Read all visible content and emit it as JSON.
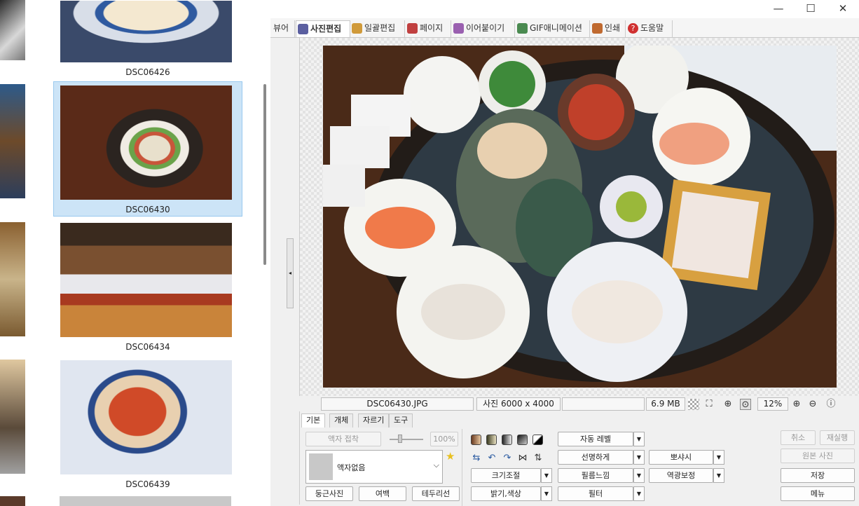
{
  "thumbnails": [
    {
      "name": "DSC06426"
    },
    {
      "name": "DSC06430"
    },
    {
      "name": "DSC06434"
    },
    {
      "name": "DSC06439"
    }
  ],
  "window": {
    "minimize": "—",
    "maximize": "☐",
    "close": "✕"
  },
  "tabs": [
    {
      "label": "뷰어",
      "color": "#5b7fbf"
    },
    {
      "label": "사진편집",
      "color": "#5b5fa0"
    },
    {
      "label": "일괄편집",
      "color": "#d09a3a"
    },
    {
      "label": "페이지",
      "color": "#c04040"
    },
    {
      "label": "이어붙이기",
      "color": "#9a60b0"
    },
    {
      "label": "GIF애니메이션",
      "color": "#4a8a50"
    },
    {
      "label": "인쇄",
      "color": "#c06a30"
    },
    {
      "label": "도움말",
      "color": "#d03030",
      "icon": "?"
    }
  ],
  "status": {
    "filename": "DSC06430.JPG",
    "dimensions": "사진 6000 x 4000",
    "extra": "",
    "filesize": "6.9 MB",
    "zoom": "12%"
  },
  "bottom_tabs": [
    "기본",
    "개체",
    "자르기",
    "도구"
  ],
  "frame": {
    "crop_button": "액자 접착",
    "percent": "100%",
    "select_value": "액자없음",
    "round_photo": "둥근사진",
    "margin": "여백",
    "border": "테두리선"
  },
  "buttons": {
    "resize": "크기조절",
    "brightness": "밝기,색상",
    "auto_level": "자동 레벨",
    "sharpen": "선명하게",
    "film": "필름느낌",
    "filter": "필터",
    "ppo": "뽀샤시",
    "backlight": "역광보정",
    "undo": "취소",
    "redo": "재실행",
    "original": "원본 사진",
    "save": "저장",
    "menu": "메뉴"
  }
}
